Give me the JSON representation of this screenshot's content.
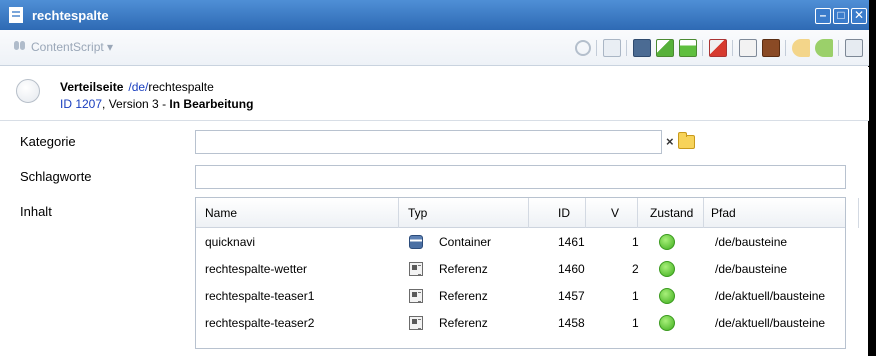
{
  "window": {
    "title": "rechtespalte"
  },
  "window_controls": {
    "minimize": "–",
    "maximize": "□",
    "close": "✕"
  },
  "toolbar": {
    "content_script_label": "ContentScript ▾",
    "icons": [
      "refresh-icon",
      "edit-icon",
      "save-icon",
      "check-edit-icon",
      "check-icon",
      "task-icon",
      "copy-icon",
      "folder-icon",
      "forward-icon",
      "forward-alt-icon",
      "preview-icon"
    ]
  },
  "header": {
    "kind": "Verteilseite",
    "path_link": "/de/",
    "path_rest": "rechtespalte",
    "id_link": "ID 1207",
    "version": ", Version 3 - ",
    "state": "In Bearbeitung"
  },
  "form": {
    "kategorie_label": "Kategorie",
    "kategorie_value": "",
    "schlagworte_label": "Schlagworte",
    "schlagworte_value": "",
    "inhalt_label": "Inhalt",
    "clear_symbol": "×"
  },
  "grid": {
    "columns": [
      "Name",
      "Typ",
      "ID",
      "V",
      "Zustand",
      "Pfad"
    ],
    "rows": [
      {
        "name": "quicknavi",
        "type": "Container",
        "type_icon": "container-icon",
        "id": "1461",
        "v": "1",
        "state_color": "#4cc02a",
        "path": "/de/bausteine"
      },
      {
        "name": "rechtespalte-wetter",
        "type": "Referenz",
        "type_icon": "reference-icon",
        "id": "1460",
        "v": "2",
        "state_color": "#4cc02a",
        "path": "/de/bausteine"
      },
      {
        "name": "rechtespalte-teaser1",
        "type": "Referenz",
        "type_icon": "reference-icon",
        "id": "1457",
        "v": "1",
        "state_color": "#4cc02a",
        "path": "/de/aktuell/bausteine"
      },
      {
        "name": "rechtespalte-teaser2",
        "type": "Referenz",
        "type_icon": "reference-icon",
        "id": "1458",
        "v": "1",
        "state_color": "#4cc02a",
        "path": "/de/aktuell/bausteine"
      }
    ]
  }
}
